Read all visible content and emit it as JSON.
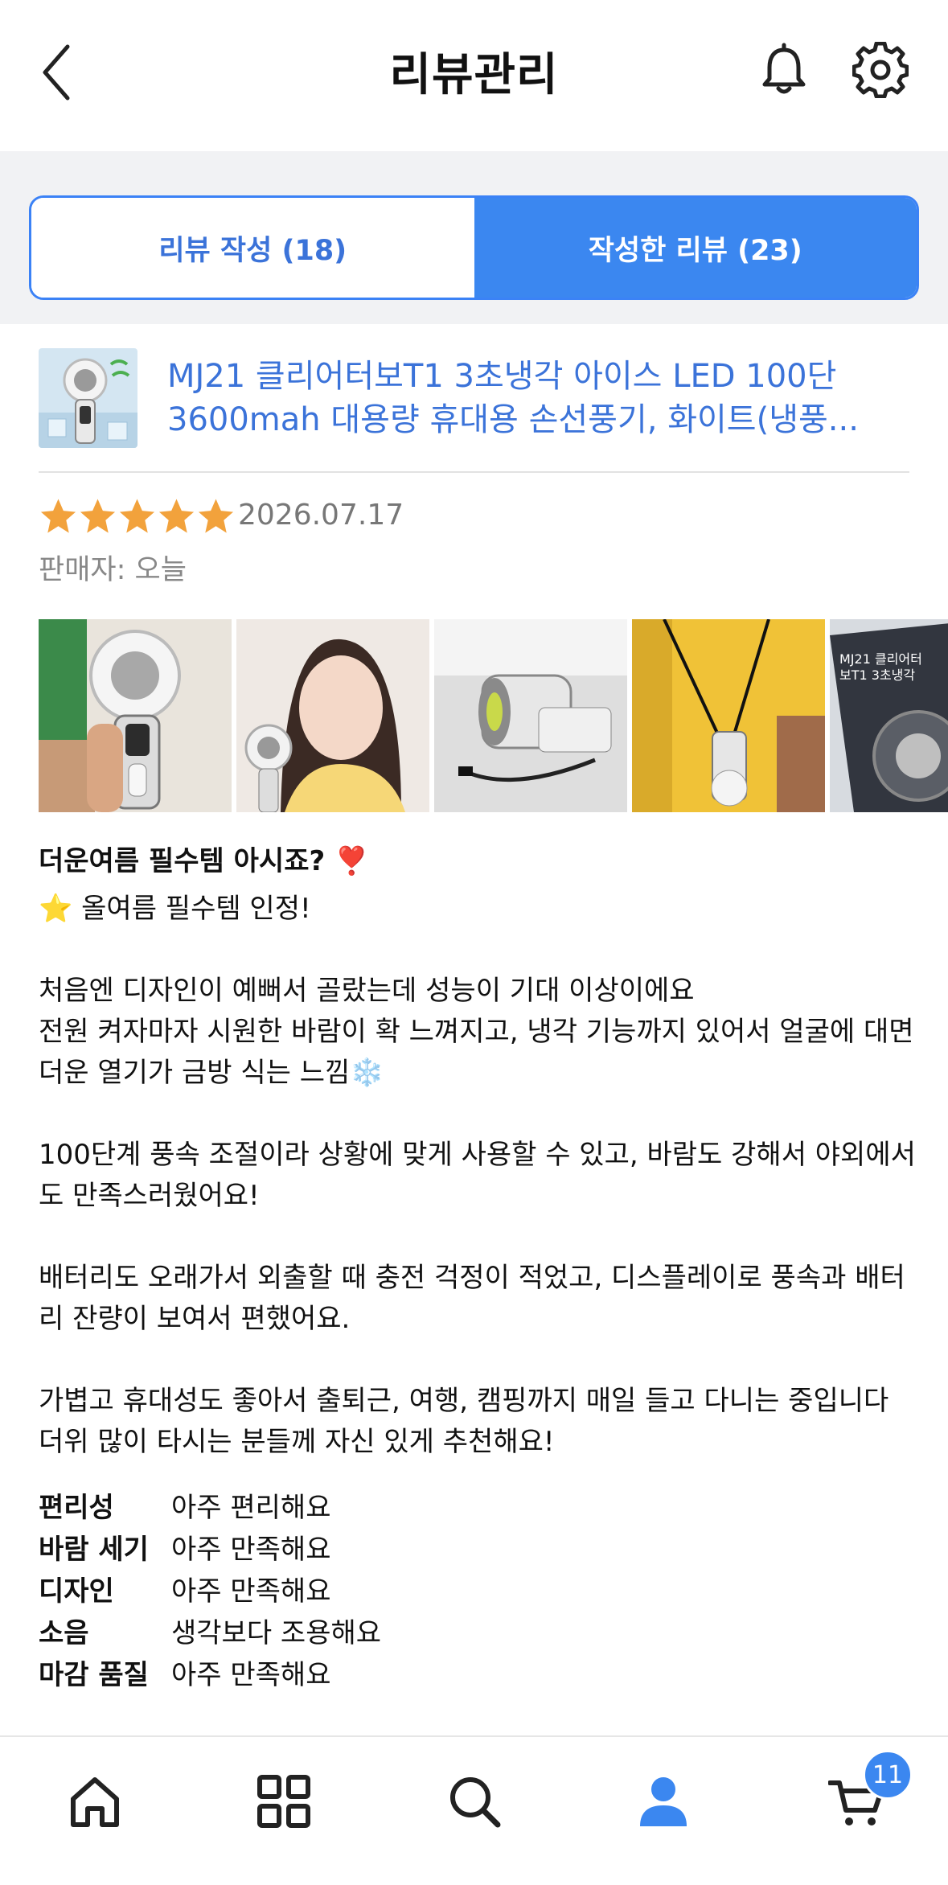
{
  "header": {
    "title": "리뷰관리",
    "back_icon": "chevron-left-icon",
    "bell_icon": "bell-icon",
    "settings_icon": "gear-icon"
  },
  "tabs": [
    {
      "label": "리뷰 작성 (18)",
      "active": false
    },
    {
      "label": "작성한 리뷰 (23)",
      "active": true
    }
  ],
  "product": {
    "name_line1": "MJ21 클리어터보T1 3초냉각 아이스 LED 100단",
    "name_line2": "3600mah 대용량 휴대용 손선풍기, 화이트(냉풍..."
  },
  "review": {
    "rating": 5,
    "date": "2026.07.17",
    "seller": "판매자: 오늘",
    "photo_count_visible": 5,
    "title": "더운여름 필수템 아시죠? ❣️",
    "body": "⭐ 올여름 필수템 인정!\n\n처음엔 디자인이 예뻐서 골랐는데 성능이 기대 이상이에요\n전원 켜자마자 시원한 바람이 확 느껴지고, 냉각 기능까지 있어서 얼굴에 대면\n더운 열기가 금방 식는 느낌❄️\n\n 100단계 풍속 조절이라 상황에 맞게 사용할 수 있고, 바람도 강해서 야외에서\n도 만족스러웠어요!\n\n 배터리도 오래가서 외출할 때 충전 걱정이 적었고, 디스플레이로 풍속과 배터\n리 잔량이 보여서 편했어요.\n\n가볍고 휴대성도 좋아서 출퇴근, 여행, 캠핑까지 매일 들고 다니는 중입니다\n더위 많이 타시는 분들께 자신 있게 추천해요!",
    "attributes": [
      {
        "label": "편리성",
        "value": "아주 편리해요"
      },
      {
        "label": "바람 세기",
        "value": "아주 만족해요"
      },
      {
        "label": "디자인",
        "value": "아주 만족해요"
      },
      {
        "label": "소음",
        "value": "생각보다 조용해요"
      },
      {
        "label": "마감 품질",
        "value": "아주 만족해요"
      }
    ]
  },
  "bottom_nav": {
    "items": [
      "home-icon",
      "grid-icon",
      "search-icon",
      "user-icon",
      "cart-icon"
    ],
    "active": "user-icon",
    "cart_badge": "11"
  },
  "colors": {
    "accent": "#3b87f0",
    "link": "#3b73d9",
    "star": "#f2a23c"
  }
}
